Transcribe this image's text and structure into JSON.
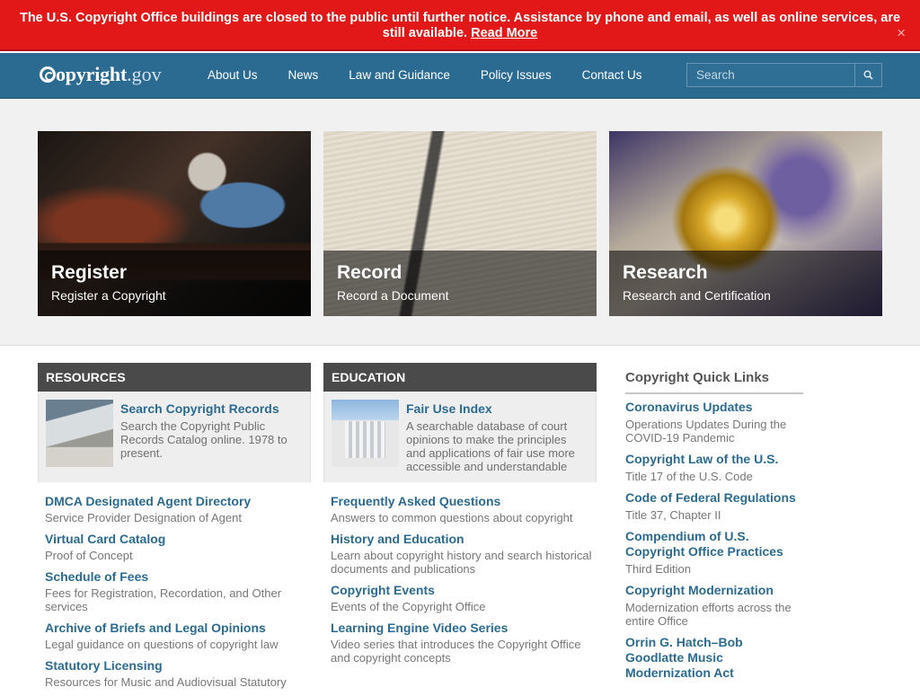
{
  "alert": {
    "message": "The U.S. Copyright Office buildings are closed to the public until further notice. Assistance by phone and email, as well as online services, are still available.",
    "link": "Read More",
    "close": "×"
  },
  "header": {
    "logo_word": "opyright",
    "logo_gov": ".gov",
    "nav": [
      "About Us",
      "News",
      "Law and Guidance",
      "Policy Issues",
      "Contact Us"
    ],
    "search_placeholder": "Search"
  },
  "hero": [
    {
      "title": "Register",
      "subtitle": "Register a Copyright"
    },
    {
      "title": "Record",
      "subtitle": "Record a Document"
    },
    {
      "title": "Research",
      "subtitle": "Research and Certification"
    }
  ],
  "resources": {
    "heading": "RESOURCES",
    "feature": {
      "title": "Search Copyright Records",
      "desc": "Search the Copyright Public Records Catalog online. 1978 to present."
    },
    "links": [
      {
        "title": "DMCA Designated Agent Directory",
        "desc": "Service Provider Designation of Agent"
      },
      {
        "title": "Virtual Card Catalog",
        "desc": "Proof of Concept"
      },
      {
        "title": "Schedule of Fees",
        "desc": "Fees for Registration, Recordation, and Other services"
      },
      {
        "title": "Archive of Briefs and Legal Opinions",
        "desc": "Legal guidance on questions of copyright law"
      },
      {
        "title": "Statutory Licensing",
        "desc": "Resources for Music and Audiovisual Statutory"
      }
    ]
  },
  "education": {
    "heading": "EDUCATION",
    "feature": {
      "title": "Fair Use Index",
      "desc": "A searchable database of court opinions to make the principles and applications of fair use more accessible and understandable"
    },
    "links": [
      {
        "title": "Frequently Asked Questions",
        "desc": "Answers to common questions about copyright"
      },
      {
        "title": "History and Education",
        "desc": "Learn about copyright history and search historical documents and publications"
      },
      {
        "title": "Copyright Events",
        "desc": "Events of the Copyright Office"
      },
      {
        "title": "Learning Engine Video Series",
        "desc": "Video series that introduces the Copyright Office and copyright concepts"
      }
    ]
  },
  "quick_links": {
    "heading": "Copyright Quick Links",
    "links": [
      {
        "title": "Coronavirus Updates",
        "desc": "Operations Updates During the COVID-19 Pandemic"
      },
      {
        "title": "Copyright Law of the U.S.",
        "desc": "Title 17 of the U.S. Code"
      },
      {
        "title": "Code of Federal Regulations",
        "desc": "Title 37, Chapter II"
      },
      {
        "title": "Compendium of U.S. Copyright Office Practices",
        "desc": "Third Edition"
      },
      {
        "title": "Copyright Modernization",
        "desc": "Modernization efforts across the entire Office"
      },
      {
        "title": "Orrin G. Hatch–Bob Goodlatte Music Modernization Act",
        "desc": ""
      }
    ]
  },
  "colors": {
    "alert": "#e21818",
    "nav": "#2b6b92",
    "link": "#2b6b92",
    "panel_head": "#4a4a4a"
  }
}
